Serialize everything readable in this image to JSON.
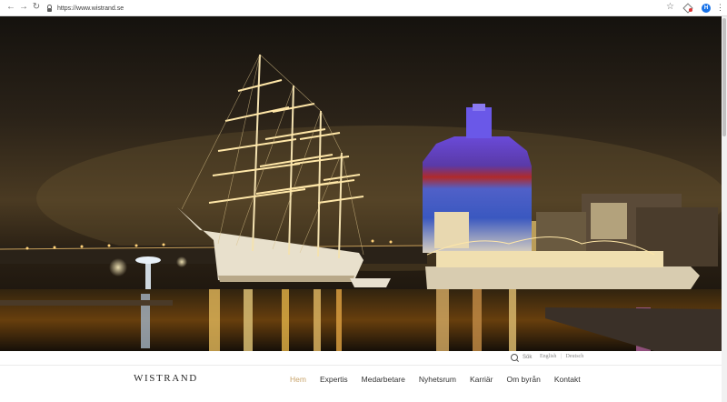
{
  "browser": {
    "url": "https://www.wistrand.se",
    "profile_initial": "H"
  },
  "hero": {
    "description_icon": "harbor-night-photo"
  },
  "utility": {
    "search_label": "Sök",
    "languages": [
      "English",
      "Deutsch"
    ],
    "separator": "|"
  },
  "header": {
    "logo": "WISTRAND",
    "nav": [
      {
        "label": "Hem",
        "active": true
      },
      {
        "label": "Expertis",
        "active": false
      },
      {
        "label": "Medarbetare",
        "active": false
      },
      {
        "label": "Nyhetsrum",
        "active": false
      },
      {
        "label": "Karriär",
        "active": false
      },
      {
        "label": "Om byrån",
        "active": false
      },
      {
        "label": "Kontakt",
        "active": false
      }
    ]
  },
  "colors": {
    "accent": "#c9a46b",
    "nav_text": "#333333"
  }
}
